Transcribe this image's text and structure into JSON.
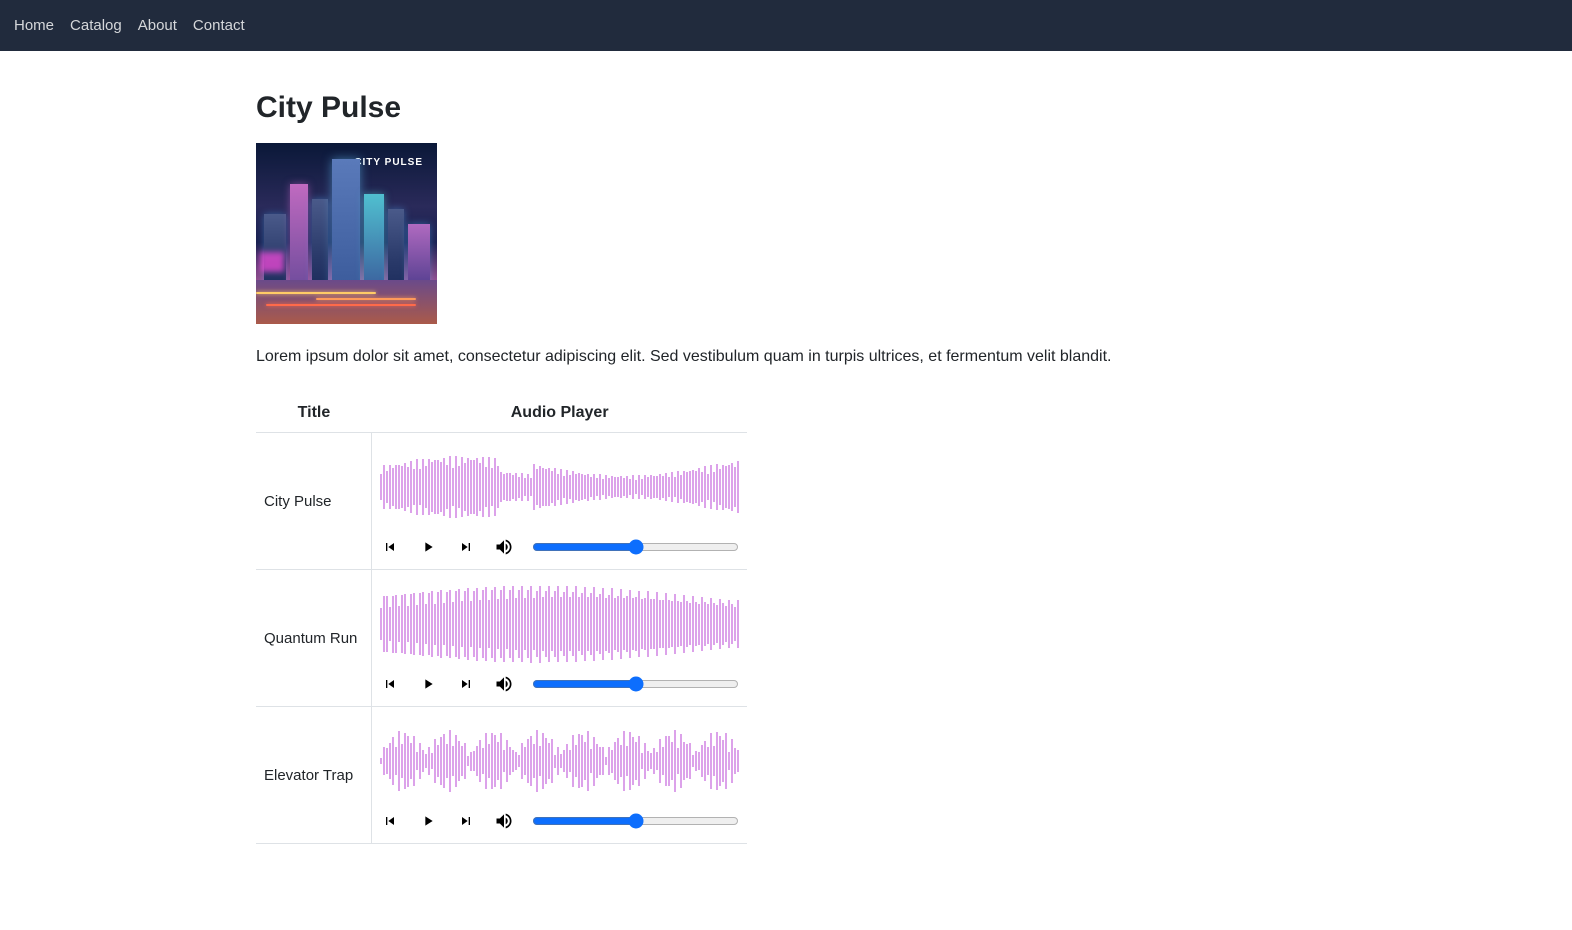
{
  "nav": {
    "items": [
      "Home",
      "Catalog",
      "About",
      "Contact"
    ]
  },
  "page": {
    "title": "City Pulse",
    "album_art_label": "CITY PULSE",
    "description": "Lorem ipsum dolor sit amet, consectetur adipiscing elit. Sed vestibulum quam in turpis ultrices, et fermentum velit blandit."
  },
  "table": {
    "headers": {
      "title": "Title",
      "player": "Audio Player"
    }
  },
  "tracks": [
    {
      "title": "City Pulse",
      "volume": 50
    },
    {
      "title": "Quantum Run",
      "volume": 50
    },
    {
      "title": "Elevator Trap",
      "volume": 50
    }
  ],
  "colors": {
    "navbar_bg": "#212b3d",
    "accent": "#0d6efd",
    "waveform": "#d99ae8"
  }
}
